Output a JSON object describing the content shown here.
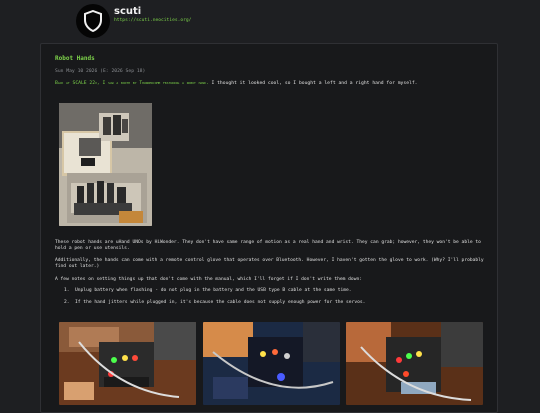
{
  "site": {
    "title": "scuti",
    "url": "https://scuti.neocities.org/",
    "logo_icon": "shield-icon"
  },
  "post": {
    "title": "Robot Hands",
    "date": "Sun May 10 2026 (E: 2026 Sep 18)",
    "intro_link": "Back at SCALE 22x, I saw a booth by Thundercomm featuring a robot hand.",
    "intro_text": " I thought it looked cool, so I bought a left and a right hand for myself.",
    "paragraphs": [
      "These robot hands are uHand UNOs by HiWonder. They don't have same range of motion as a real hand and wrist. They can grab; however, they won't be able to hold a pen or use utensils.",
      "Additionally, the hands can come with a remote control glove that operates over Bluetooth. However, I haven't gotten the glove to work. (Why? I'll probably find out later.)",
      "A few notes on setting things up that don't come with the manual, which I'll forget if I don't write them down:"
    ],
    "notes": [
      {
        "num": "1.",
        "text": "Unplug battery when flashing - do not plug in the battery and the USB type B cable at the same time."
      },
      {
        "num": "2.",
        "text": "If the hand jitters while plugged in, it's because the cable does not supply enough power for the servos."
      }
    ]
  },
  "colors": {
    "background": "#1e1f22",
    "card": "#18191b",
    "accent": "#7dd34a",
    "text": "#e0e0e0",
    "muted": "#8b8e92"
  }
}
